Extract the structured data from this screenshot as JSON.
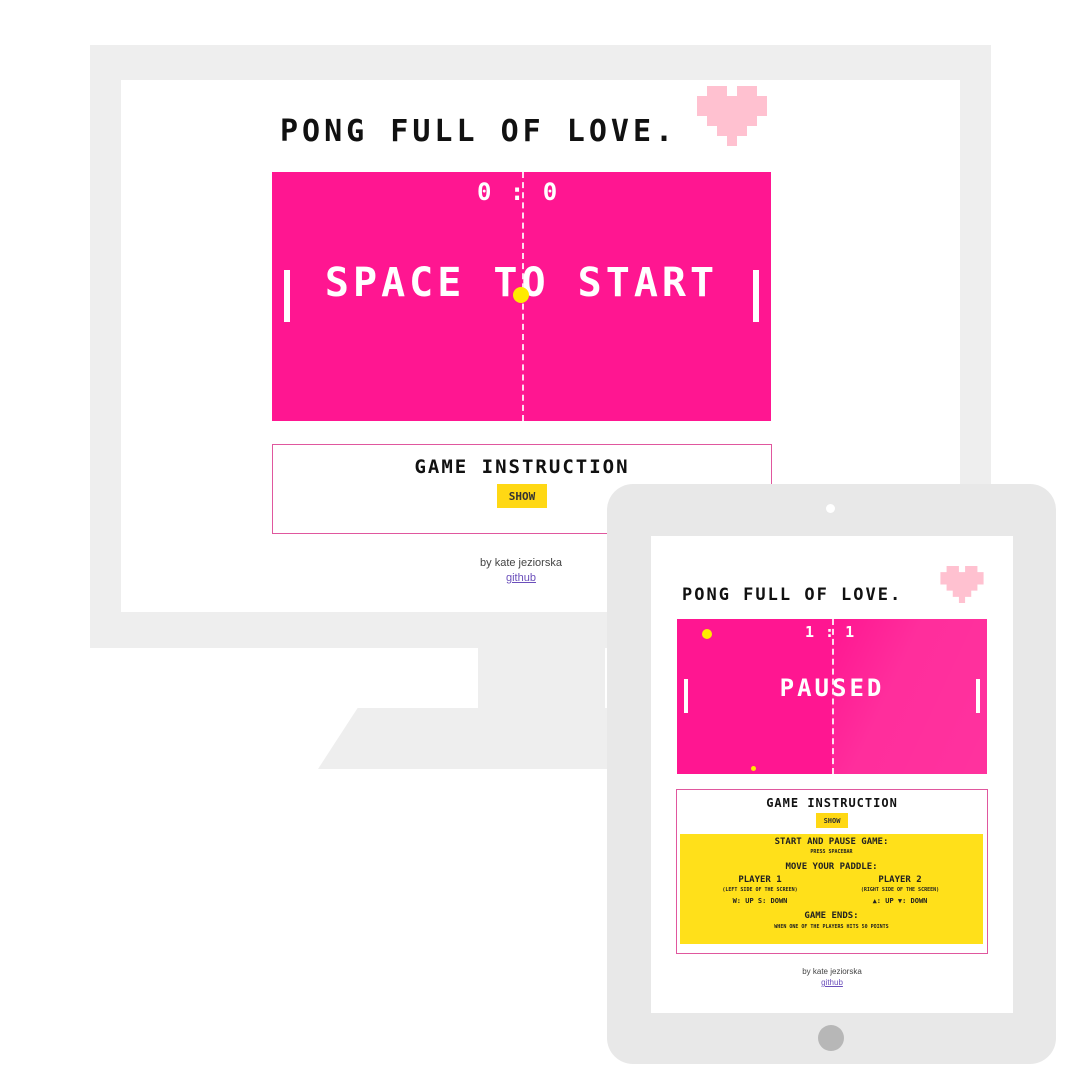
{
  "desktop": {
    "title": "PONG FULL OF LOVE.",
    "score": "0 : 0",
    "message": "SPACE TO START",
    "instruction_title": "GAME INSTRUCTION",
    "show_button": "SHOW",
    "credit": "by kate jeziorska",
    "github_link": "github"
  },
  "tablet": {
    "title": "PONG FULL OF LOVE.",
    "score": "1 : 1",
    "message": "PAUSED",
    "instruction_title": "GAME INSTRUCTION",
    "show_button": "SHOW",
    "instructions": {
      "start_heading": "START AND PAUSE GAME:",
      "start_text": "PRESS SPACEBAR",
      "move_heading": "MOVE YOUR PADDLE:",
      "player1_heading": "PLAYER 1",
      "player1_side": "(LEFT SIDE OF THE SCREEN)",
      "player1_keys": "W: UP S: DOWN",
      "player2_heading": "PLAYER 2",
      "player2_side": "(RIGHT SIDE OF THE SCREEN)",
      "player2_keys": "▲: UP ▼: DOWN",
      "end_heading": "GAME ENDS:",
      "end_text": "WHEN ONE OF THE PLAYERS HITS 50 POINTS"
    },
    "credit": "by kate jeziorska",
    "github_link": "github"
  },
  "colors": {
    "field": "#ff1691",
    "ball": "#ffea00",
    "button": "#ffd814",
    "heart": "#ffc1d0",
    "device_frame": "#eeeeee"
  },
  "icons": [
    "heart-icon"
  ]
}
